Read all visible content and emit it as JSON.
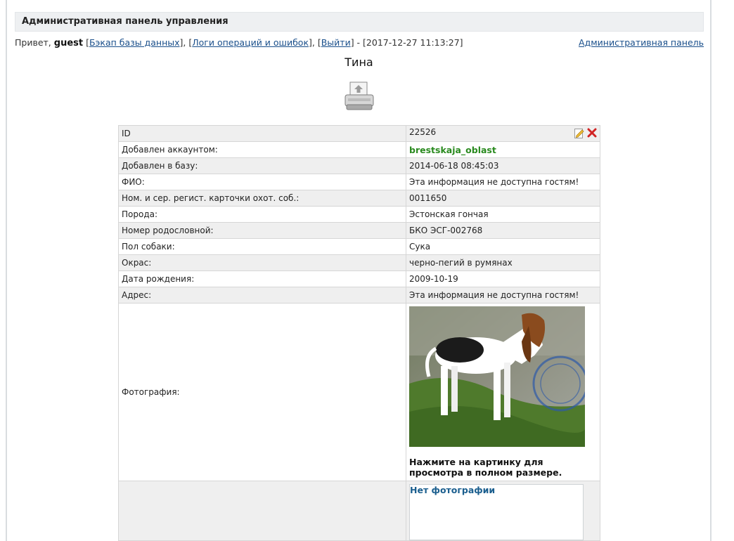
{
  "header": {
    "title": "Административная панель управления"
  },
  "userline": {
    "greeting": "Привет,",
    "username": "guest",
    "backup_link": "Бэкап базы данных",
    "logs_link": "Логи операций и ошибок",
    "logout_link": "Выйти",
    "timestamp": "[2017-12-27 11:13:27]",
    "admin_link": "Административная панель"
  },
  "record": {
    "name": "Тина",
    "rows": [
      {
        "label": "ID",
        "value": "22526"
      },
      {
        "label": "Добавлен аккаунтом:",
        "value": "brestskaja_oblast"
      },
      {
        "label": "Добавлен в базу:",
        "value": "2014-06-18 08:45:03"
      },
      {
        "label": "ФИО:",
        "value": "Эта информация не доступна гостям!"
      },
      {
        "label": "Ном. и сер. регист. карточки охот. соб.:",
        "value": "0011650"
      },
      {
        "label": "Порода:",
        "value": "Эстонская гончая"
      },
      {
        "label": "Номер родословной:",
        "value": "БКО ЭСГ-002768"
      },
      {
        "label": "Пол собаки:",
        "value": "Сука"
      },
      {
        "label": "Окрас:",
        "value": "черно-пегий в румянах"
      },
      {
        "label": "Дата рождения:",
        "value": "2009-10-19"
      },
      {
        "label": "Адрес:",
        "value": "Эта информация не доступна гостям!"
      },
      {
        "label": "Фотография:",
        "value": "Нажмите на картинку для просмотра в полном размере."
      }
    ],
    "no_photo": "Нет фотографии"
  },
  "colors": {
    "link": "#1a4f8b",
    "account": "#2a8a1f",
    "row_alt": "#efefef",
    "header_bg": "#eef0f2"
  },
  "icons": [
    "printer-icon",
    "edit-icon",
    "delete-icon"
  ]
}
